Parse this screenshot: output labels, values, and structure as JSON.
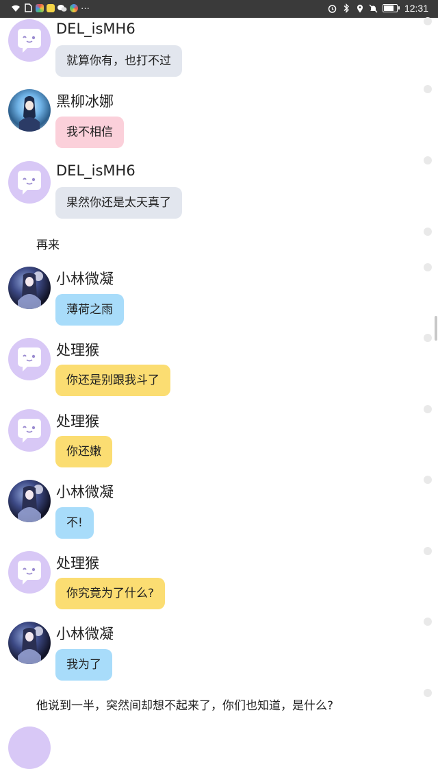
{
  "status_bar": {
    "time": "12:31",
    "overflow_indicator": "···",
    "battery_level_percent": 85,
    "left_icons": [
      "wifi-icon",
      "sim-icon",
      "app-icon-multicolor",
      "app-icon-yellow",
      "wechat-icon",
      "app-icon-rainbow"
    ],
    "right_icons": [
      "alarm-icon",
      "bluetooth-icon",
      "location-icon",
      "mute-icon",
      "battery-icon"
    ]
  },
  "messages": [
    {
      "type": "chat",
      "name": "DEL_isMH6",
      "text": "就算你有，也打不过",
      "avatar": "bot-face-avatar",
      "bubble_color": "#e2e6ee"
    },
    {
      "type": "chat",
      "name": "黑柳冰娜",
      "text": "我不相信",
      "avatar": "anime-girl-avatar",
      "bubble_color": "#fbd0da"
    },
    {
      "type": "chat",
      "name": "DEL_isMH6",
      "text": "果然你还是太天真了",
      "avatar": "bot-face-avatar",
      "bubble_color": "#e2e6ee"
    },
    {
      "type": "narration",
      "text": "再来"
    },
    {
      "type": "chat",
      "name": "小林微凝",
      "text": "薄荷之雨",
      "avatar": "anime-girl-avatar",
      "bubble_color": "#a8dcfa"
    },
    {
      "type": "chat",
      "name": "处理猴",
      "text": "你还是别跟我斗了",
      "avatar": "bot-face-avatar",
      "bubble_color": "#fbdd72"
    },
    {
      "type": "chat",
      "name": "处理猴",
      "text": "你还嫩",
      "avatar": "bot-face-avatar",
      "bubble_color": "#fbdd72"
    },
    {
      "type": "chat",
      "name": "小林微凝",
      "text": "不!",
      "avatar": "anime-girl-avatar",
      "bubble_color": "#a8dcfa"
    },
    {
      "type": "chat",
      "name": "处理猴",
      "text": "你究竟为了什么?",
      "avatar": "bot-face-avatar",
      "bubble_color": "#fbdd72"
    },
    {
      "type": "chat",
      "name": "小林微凝",
      "text": "我为了",
      "avatar": "anime-girl-avatar",
      "bubble_color": "#a8dcfa"
    },
    {
      "type": "narration",
      "text": "他说到一半，突然间却想不起来了，你们也知道，是什么?"
    }
  ]
}
